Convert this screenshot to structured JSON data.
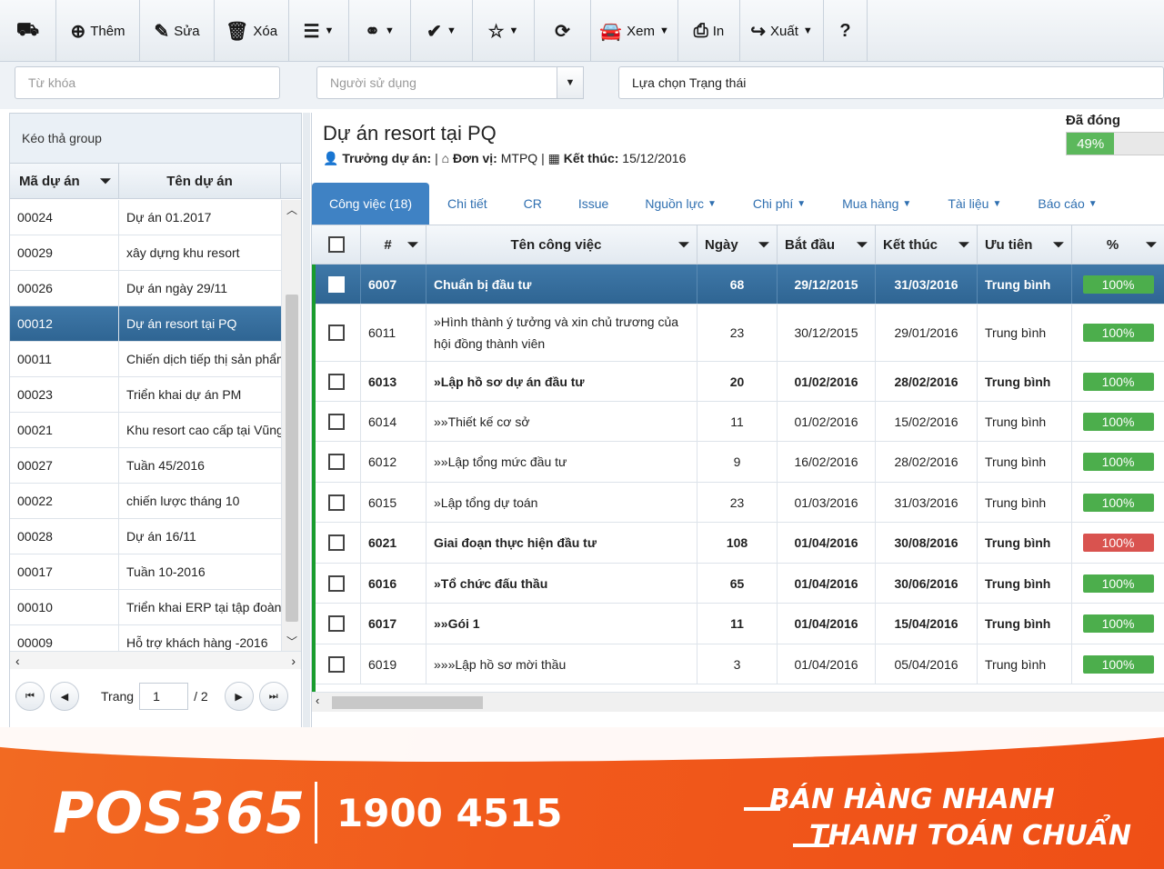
{
  "toolbar": {
    "items": [
      {
        "icon": "binoculars-icon",
        "glyph": "⛟",
        "label": "",
        "caret": false
      },
      {
        "icon": "plus-circle-icon",
        "glyph": "⊕",
        "label": "Thêm",
        "caret": false
      },
      {
        "icon": "pencil-icon",
        "glyph": "✎",
        "label": "Sửa",
        "caret": false
      },
      {
        "icon": "trash-icon",
        "glyph": "🗑",
        "label": "Xóa",
        "caret": false
      },
      {
        "icon": "menu-icon",
        "glyph": "☰",
        "label": "",
        "caret": true
      },
      {
        "icon": "link-icon",
        "glyph": "⚭",
        "label": "",
        "caret": true
      },
      {
        "icon": "check-circle-icon",
        "glyph": "✔",
        "label": "",
        "caret": true
      },
      {
        "icon": "star-icon",
        "glyph": "☆",
        "label": "",
        "caret": true
      },
      {
        "icon": "refresh-icon",
        "glyph": "⟳",
        "label": "",
        "caret": false
      },
      {
        "icon": "car-icon",
        "glyph": "🚘",
        "label": "Xem",
        "caret": true
      },
      {
        "icon": "printer-icon",
        "glyph": "⎙",
        "label": "In",
        "caret": false
      },
      {
        "icon": "share-icon",
        "glyph": "↪",
        "label": "Xuất",
        "caret": true
      },
      {
        "icon": "help-icon",
        "glyph": "?",
        "label": "",
        "caret": false
      }
    ]
  },
  "filters": {
    "keyword_placeholder": "Từ khóa",
    "user_placeholder": "Người sử dụng",
    "status_value": "Lựa chọn Trạng thái"
  },
  "left": {
    "group_bar": "Kéo thả group",
    "col_code": "Mã dự án",
    "col_name": "Tên dự án",
    "rows": [
      {
        "code": "00024",
        "name": "Dự án 01.2017"
      },
      {
        "code": "00029",
        "name": "xây dựng khu resort"
      },
      {
        "code": "00026",
        "name": "Dự án ngày 29/11"
      },
      {
        "code": "00012",
        "name": "Dự án resort tại PQ",
        "selected": true
      },
      {
        "code": "00011",
        "name": "Chiến dịch tiếp thị sản phẩm"
      },
      {
        "code": "00023",
        "name": "Triển khai dự án PM"
      },
      {
        "code": "00021",
        "name": "Khu resort cao cấp tại Vũng Tàu"
      },
      {
        "code": "00027",
        "name": "Tuần 45/2016"
      },
      {
        "code": "00022",
        "name": "chiến lược tháng 10"
      },
      {
        "code": "00028",
        "name": "Dự án 16/11"
      },
      {
        "code": "00017",
        "name": "Tuần 10-2016"
      },
      {
        "code": "00010",
        "name": "Triển khai ERP tại tập đoàn X"
      },
      {
        "code": "00009",
        "name": "Hỗ trợ khách hàng -2016"
      }
    ],
    "pager": {
      "label": "Trang",
      "page": "1",
      "total": "/ 2"
    }
  },
  "project": {
    "title": "Dự án resort tại PQ",
    "manager_label": "Trưởng dự án:",
    "unit_label": "Đơn vị:",
    "unit_value": "MTPQ",
    "end_label": "Kết thúc:",
    "end_value": "15/12/2016",
    "status_label": "Đã đóng",
    "progress_text": "49%",
    "progress": 49
  },
  "tabs": [
    {
      "label": "Công việc (18)",
      "active": true,
      "caret": false
    },
    {
      "label": "Chi tiết",
      "caret": false
    },
    {
      "label": "CR",
      "caret": false
    },
    {
      "label": "Issue",
      "caret": false
    },
    {
      "label": "Nguồn lực",
      "caret": true
    },
    {
      "label": "Chi phí",
      "caret": true
    },
    {
      "label": "Mua hàng",
      "caret": true
    },
    {
      "label": "Tài liệu",
      "caret": true
    },
    {
      "label": "Báo cáo",
      "caret": true
    }
  ],
  "grid": {
    "headers": {
      "id": "#",
      "name": "Tên công việc",
      "days": "Ngày",
      "start": "Bắt đầu",
      "end": "Kết thúc",
      "priority": "Ưu tiên",
      "percent": "%"
    },
    "rows": [
      {
        "id": "6007",
        "name": "Chuẩn bị đầu tư",
        "days": "68",
        "start": "29/12/2015",
        "end": "31/03/2016",
        "priority": "Trung bình",
        "pct": "100%",
        "color": "#4cae4c",
        "selected": true,
        "bold": true,
        "h": 44
      },
      {
        "id": "6011",
        "name": "»Hình thành ý tưởng và xin chủ trương của hội đồng thành viên",
        "days": "23",
        "start": "30/12/2015",
        "end": "29/01/2016",
        "priority": "Trung bình",
        "pct": "100%",
        "color": "#4cae4c",
        "h": 63
      },
      {
        "id": "6013",
        "name": "»Lập hồ sơ dự án đầu tư",
        "days": "20",
        "start": "01/02/2016",
        "end": "28/02/2016",
        "priority": "Trung bình",
        "pct": "100%",
        "color": "#4cae4c",
        "bold": true,
        "h": 44
      },
      {
        "id": "6014",
        "name": "»»Thiết kế cơ sở",
        "days": "11",
        "start": "01/02/2016",
        "end": "15/02/2016",
        "priority": "Trung bình",
        "pct": "100%",
        "color": "#4cae4c",
        "h": 44
      },
      {
        "id": "6012",
        "name": "»»Lập tổng mức đầu tư",
        "days": "9",
        "start": "16/02/2016",
        "end": "28/02/2016",
        "priority": "Trung bình",
        "pct": "100%",
        "color": "#4cae4c",
        "h": 45
      },
      {
        "id": "6015",
        "name": "»Lập tổng dự toán",
        "days": "23",
        "start": "01/03/2016",
        "end": "31/03/2016",
        "priority": "Trung bình",
        "pct": "100%",
        "color": "#4cae4c",
        "h": 44
      },
      {
        "id": "6021",
        "name": "Giai đoạn thực hiện đầu tư",
        "days": "108",
        "start": "01/04/2016",
        "end": "30/08/2016",
        "priority": "Trung bình",
        "pct": "100%",
        "color": "#d9534f",
        "bold": true,
        "h": 45
      },
      {
        "id": "6016",
        "name": "»Tổ chức đấu thầu",
        "days": "65",
        "start": "01/04/2016",
        "end": "30/06/2016",
        "priority": "Trung bình",
        "pct": "100%",
        "color": "#4cae4c",
        "bold": true,
        "h": 44
      },
      {
        "id": "6017",
        "name": "»»Gói 1",
        "days": "11",
        "start": "01/04/2016",
        "end": "15/04/2016",
        "priority": "Trung bình",
        "pct": "100%",
        "color": "#4cae4c",
        "bold": true,
        "h": 45
      },
      {
        "id": "6019",
        "name": "»»»Lập hồ sơ mời thầu",
        "days": "3",
        "start": "01/04/2016",
        "end": "05/04/2016",
        "priority": "Trung bình",
        "pct": "100%",
        "color": "#4cae4c",
        "h": 44
      }
    ]
  },
  "banner": {
    "logo": "POS365",
    "hotline": "1900 4515",
    "slogan1": "BÁN HÀNG NHANH",
    "slogan2": "THANH TOÁN CHUẨN"
  }
}
